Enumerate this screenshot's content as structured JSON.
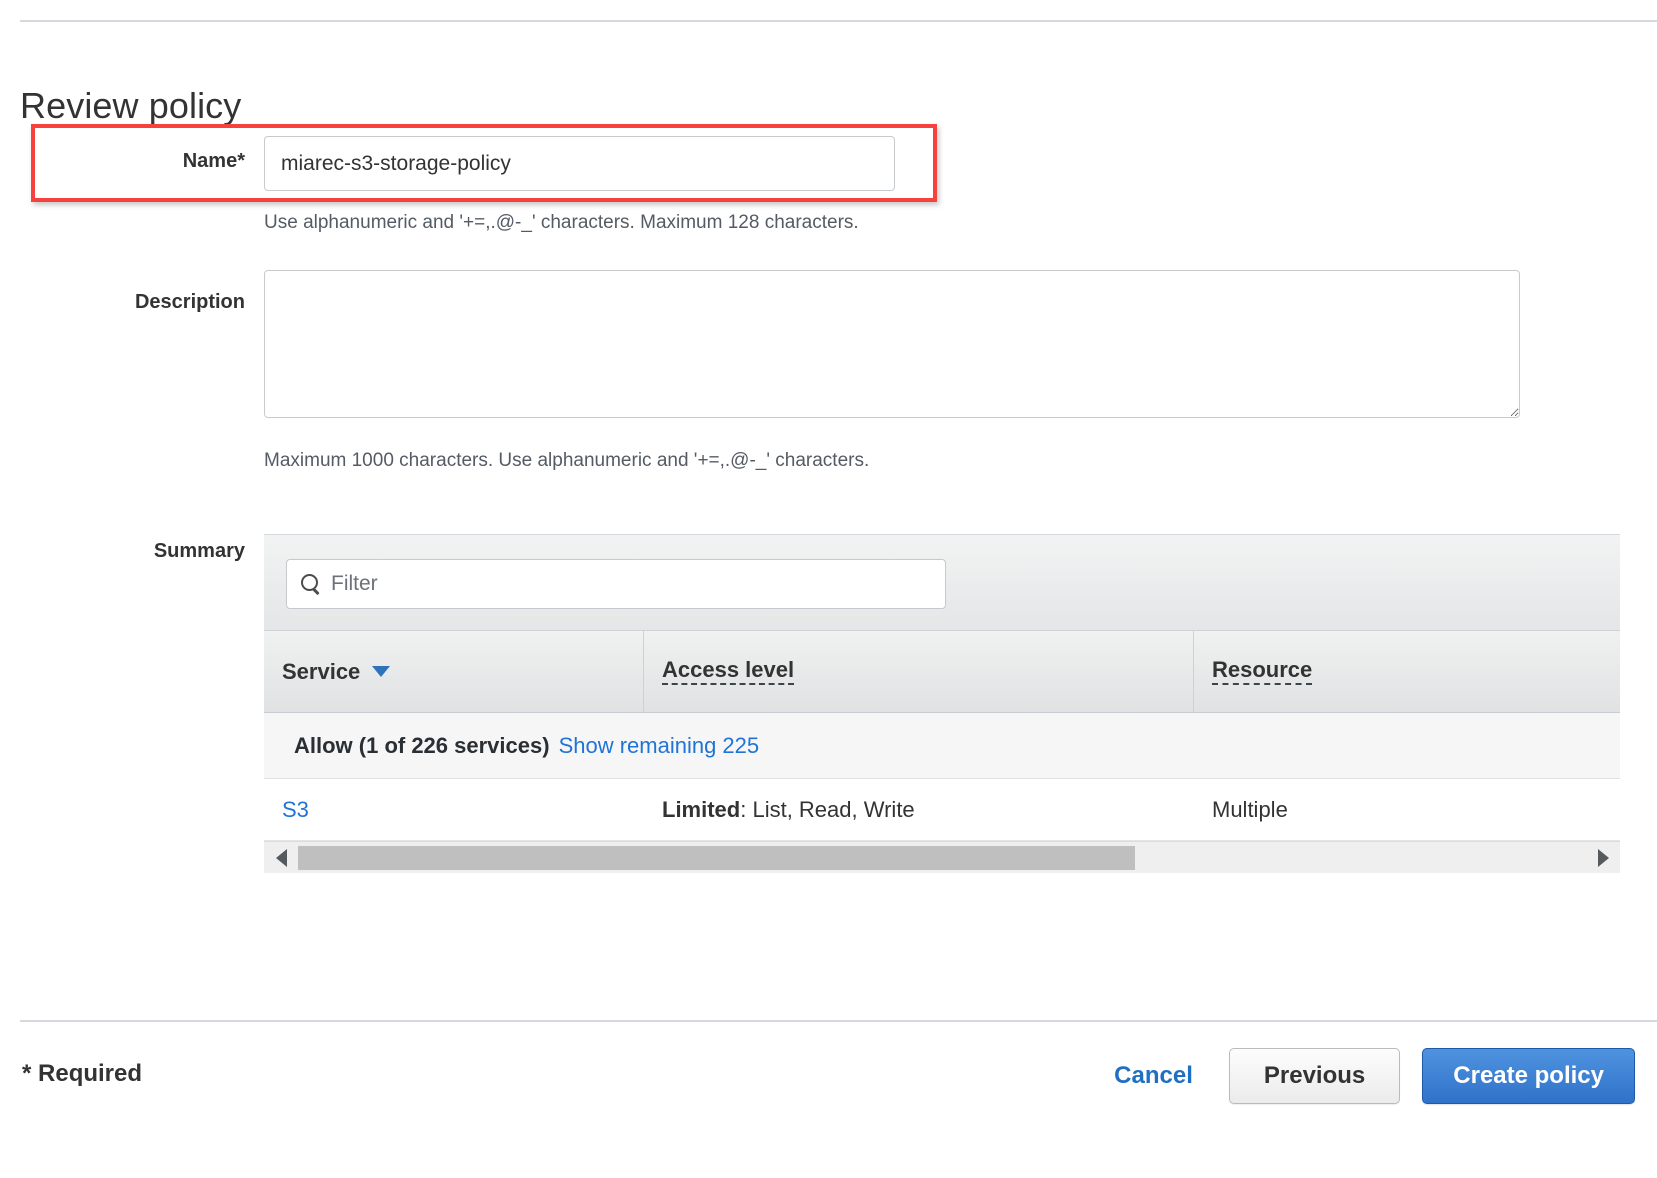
{
  "page": {
    "title": "Review policy"
  },
  "form": {
    "name": {
      "label": "Name*",
      "value": "miarec-s3-storage-policy",
      "placeholder": "",
      "help": "Use alphanumeric and '+=,.@-_' characters. Maximum 128 characters."
    },
    "description": {
      "label": "Description",
      "value": "",
      "placeholder": "",
      "help": "Maximum 1000 characters. Use alphanumeric and '+=,.@-_' characters."
    },
    "summary": {
      "label": "Summary"
    }
  },
  "summary": {
    "filter": {
      "placeholder": "Filter",
      "value": "",
      "icon": "search-icon"
    },
    "columns": [
      {
        "label": "Service",
        "sort_icon": "chevron-down-icon",
        "sorted": true
      },
      {
        "label": "Access level",
        "dotted": true
      },
      {
        "label": "Resource",
        "dotted": true
      }
    ],
    "group": {
      "text": "Allow (1 of 226 services)",
      "link": "Show remaining 225"
    },
    "rows": [
      {
        "service": "S3",
        "access_level_prefix": "Limited",
        "access_level_value": ": List, Read, Write",
        "resource": "Multiple"
      }
    ],
    "scrollbar": {
      "left_arrow": "chevron-left-icon",
      "right_arrow": "chevron-right-icon",
      "thumb_percent": 65
    }
  },
  "footer": {
    "required_note": "* Required",
    "cancel_label": "Cancel",
    "previous_label": "Previous",
    "create_label": "Create policy"
  },
  "colors": {
    "highlight": "#f7413f",
    "link": "#2074d5",
    "primary_button": "#2f72c9",
    "sort_caret": "#2f72bb"
  }
}
